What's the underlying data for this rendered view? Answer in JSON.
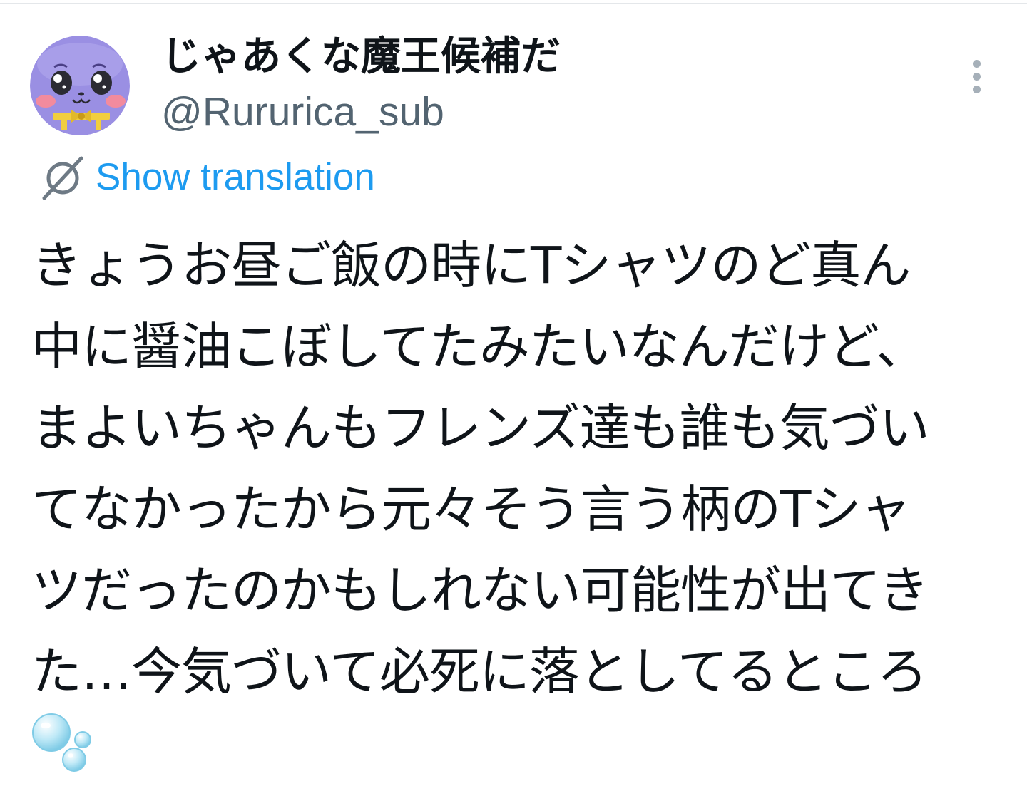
{
  "user": {
    "display_name": "じゃあくな魔王候補だ",
    "handle": "@Rururica_sub",
    "avatar": "purple-creature-avatar"
  },
  "actions": {
    "more_icon": "more-vertical-icon",
    "translation_icon": "globe-translate-icon",
    "translation_label": "Show translation"
  },
  "tweet": {
    "lines": [
      "きょうお昼ご飯の時にTシャツのど真ん",
      "中に醤油こぼしてたみたいなんだけど、",
      "まよいちゃんもフレンズ達も誰も気づい",
      "てなかったから元々そう言う柄のTシャ",
      "ツだったのかもしれない可能性が出てき",
      "た…今気づいて必死に落としてるところ"
    ],
    "emoji": "bubbles-emoji"
  },
  "colors": {
    "text_primary": "#0f1419",
    "text_secondary": "#536471",
    "link": "#1d9bf0",
    "avatar_purple": "#9a8fe3",
    "divider": "#e4e7ea"
  }
}
